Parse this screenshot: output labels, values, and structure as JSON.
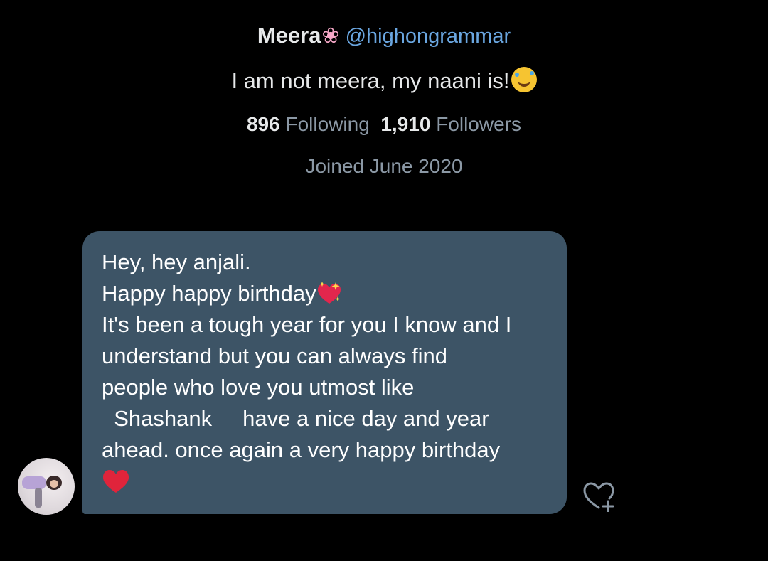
{
  "profile": {
    "display_name": "Meera",
    "name_emoji": "❀",
    "handle": "@highongrammar",
    "bio": "I am not meera, my naani is!",
    "bio_emoji": "rolling-on-floor-laughing-icon",
    "following_count": "896",
    "following_label": "Following",
    "followers_count": "1,910",
    "followers_label": "Followers",
    "joined": "Joined June 2020"
  },
  "message": {
    "lines": [
      "Hey, hey anjali.",
      "Happy happy birthday",
      "It's been a tough year for you I know and I",
      "understand but you can always find",
      "people who love you utmost like",
      "  Shashank     have a nice day and year",
      "ahead. once again a very happy birthday"
    ],
    "line2_emoji": "sparkling-heart-icon",
    "end_emoji": "red-heart-icon"
  },
  "colors": {
    "background": "#000000",
    "bubble": "#3d5466",
    "handle": "#6aa6e0",
    "muted": "#8b98a5",
    "heart_red": "#e0243b"
  }
}
